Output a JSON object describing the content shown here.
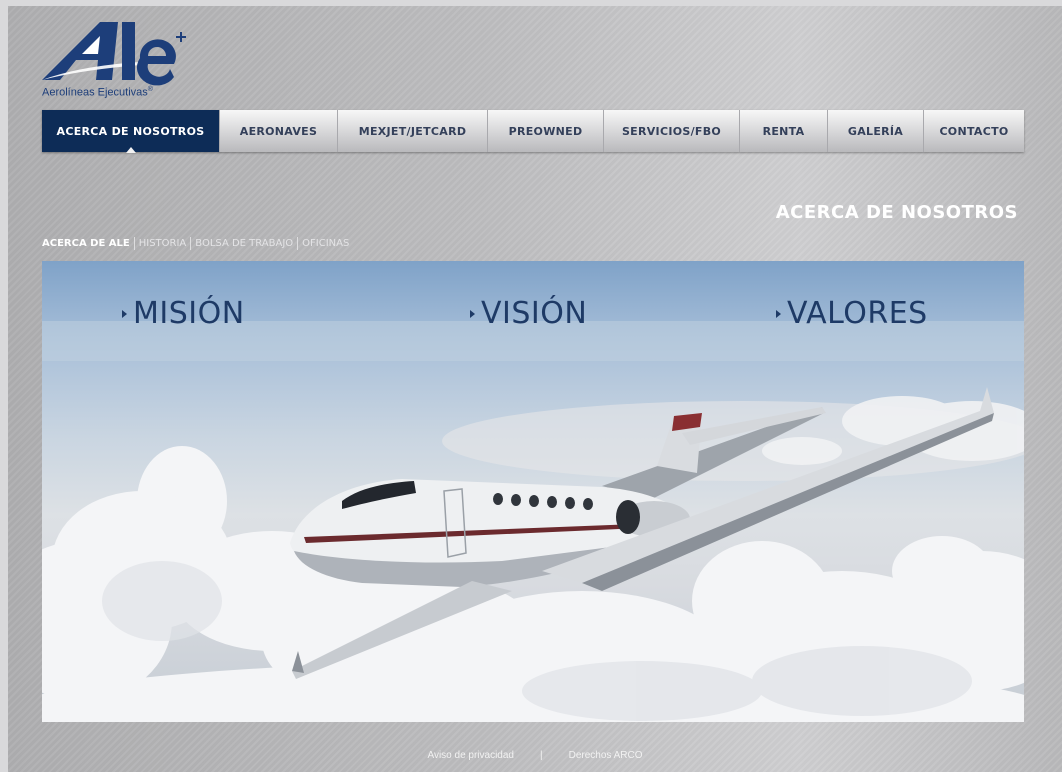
{
  "brand": {
    "logo_mark": "Ale",
    "logo_plus": "+",
    "tagline": "Aerolíneas Ejecutivas",
    "tagline_mark": "®",
    "color": "#1d3e7a"
  },
  "nav": {
    "items": [
      {
        "label": "ACERCA DE NOSOTROS",
        "active": true
      },
      {
        "label": "AERONAVES"
      },
      {
        "label": "MEXJET/JETCARD"
      },
      {
        "label": "PREOWNED"
      },
      {
        "label": "SERVICIOS/FBO"
      },
      {
        "label": "RENTA"
      },
      {
        "label": "GALERÍA"
      },
      {
        "label": "CONTACTO"
      }
    ],
    "active_color": "#0d2c57"
  },
  "page": {
    "title": "ACERCA DE NOSOTROS"
  },
  "subnav": {
    "items": [
      {
        "label": "ACERCA DE ALE",
        "active": true
      },
      {
        "label": "HISTORIA"
      },
      {
        "label": "BOLSA DE TRABAJO"
      },
      {
        "label": "OFICINAS"
      }
    ]
  },
  "hero": {
    "links": [
      {
        "label": "MISIÓN",
        "icon": "triangle-right-icon"
      },
      {
        "label": "VISIÓN",
        "icon": "triangle-right-icon"
      },
      {
        "label": "VALORES",
        "icon": "triangle-right-icon"
      }
    ],
    "image": "business-jet-above-clouds"
  },
  "footer": {
    "privacy": "Aviso de privacidad",
    "separator": "|",
    "arco": "Derechos ARCO"
  }
}
